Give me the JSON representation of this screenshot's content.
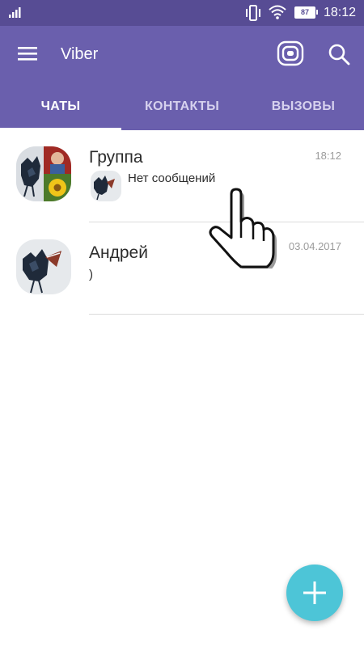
{
  "status_bar": {
    "battery": "87",
    "time": "18:12"
  },
  "app_bar": {
    "title": "Viber"
  },
  "tabs": [
    {
      "label": "ЧАТЫ",
      "active": true
    },
    {
      "label": "КОНТАКТЫ",
      "active": false
    },
    {
      "label": "ВЫЗОВЫ",
      "active": false
    }
  ],
  "chats": [
    {
      "name": "Группа",
      "time": "18:12",
      "message": "Нет сообщений"
    },
    {
      "name": "Андрей",
      "time": "03.04.2017",
      "message": ")"
    }
  ],
  "colors": {
    "header": "#6a5fad",
    "status_bar": "#574c94",
    "fab": "#4dc5d7"
  },
  "icons": [
    "signal-icon",
    "vibrate-icon",
    "wifi-icon",
    "battery-icon",
    "menu-icon",
    "stories-icon",
    "search-icon",
    "hand-pointer-icon",
    "plus-icon"
  ]
}
